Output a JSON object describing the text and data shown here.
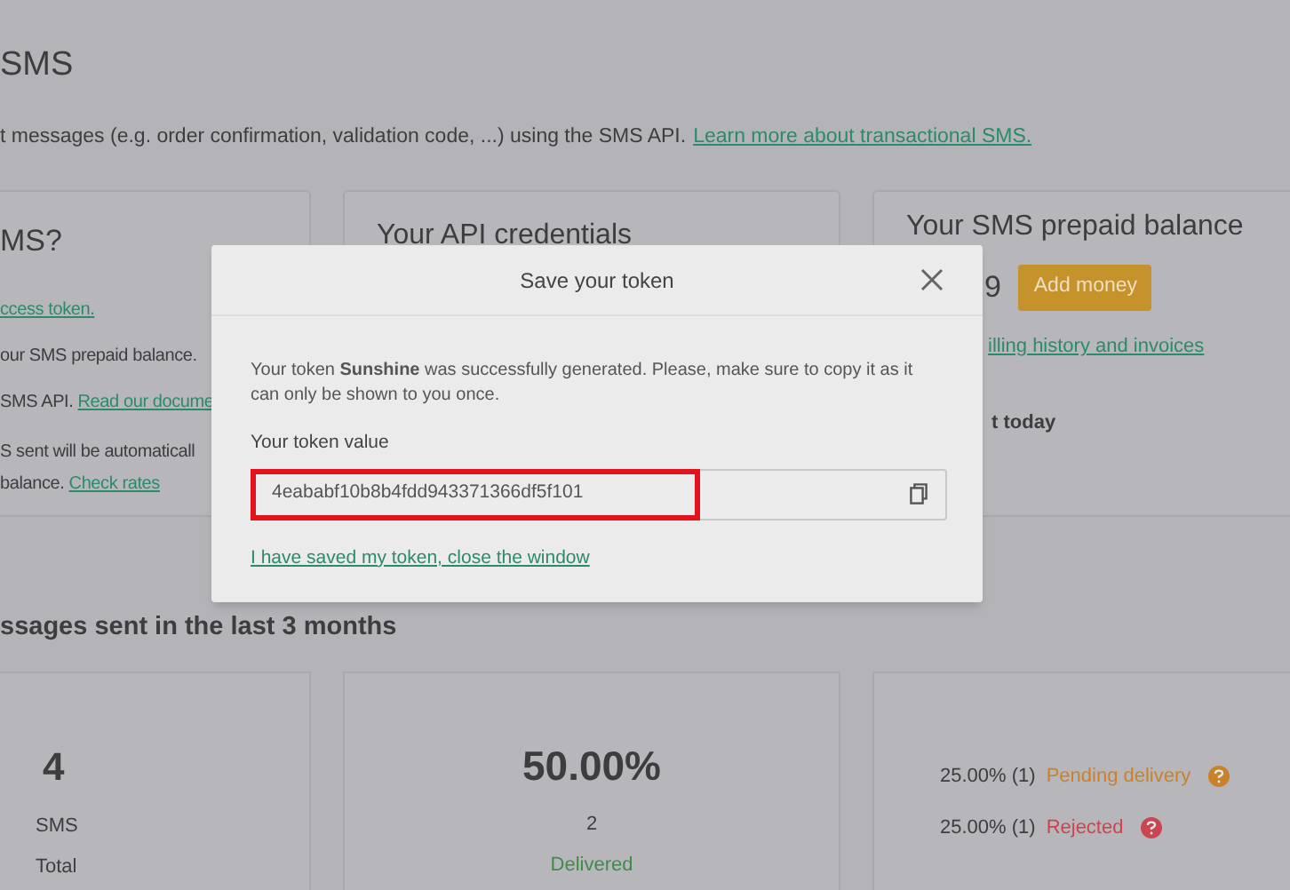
{
  "page": {
    "title": "SMS",
    "intro": "t messages (e.g. order confirmation, validation code, ...) using the SMS API.",
    "intro_link": "Learn more about transactional SMS."
  },
  "left_card": {
    "title": "MS?",
    "lines": [
      {
        "parts": [
          {
            "kind": "link",
            "text": "ccess token."
          }
        ]
      },
      {
        "parts": [
          {
            "kind": "text",
            "text": "our SMS prepaid balance."
          }
        ]
      },
      {
        "parts": [
          {
            "kind": "text",
            "text": "SMS API. "
          },
          {
            "kind": "link",
            "text": "Read our docume"
          }
        ]
      },
      {
        "parts": [
          {
            "kind": "text",
            "text": "S sent will be automaticall"
          }
        ]
      },
      {
        "parts": [
          {
            "kind": "text",
            "text": "balance. "
          },
          {
            "kind": "link",
            "text": "Check rates"
          }
        ]
      }
    ]
  },
  "api_card": {
    "title": "Your API credentials"
  },
  "balance_card": {
    "title": "Your SMS prepaid balance",
    "amount": "9",
    "button": "Add money",
    "link": "illing history and invoices",
    "note": "t today"
  },
  "stats_title": "ssages sent in the last 3 months",
  "stats": {
    "total": {
      "value": "4",
      "unit": "SMS",
      "label": "Total"
    },
    "delivered": {
      "value": "50.00%",
      "count": "2",
      "label": "Delivered"
    },
    "others": [
      {
        "share": "25.00% (1)",
        "label": "Pending delivery",
        "color": "#c9822a"
      },
      {
        "share": "25.00% (1)",
        "label": "Rejected",
        "color": "#c9454f"
      }
    ]
  },
  "dialog": {
    "title": "Save your token",
    "message": "Your token **Sunshine** was successfully generated. Please, make sure to copy it as it can only be shown to you once.",
    "field_label": "Your token value",
    "token": "4eababf10b8b4fdd943371366df5f101",
    "highlighted": true,
    "link": "I have saved my token, close the window"
  }
}
